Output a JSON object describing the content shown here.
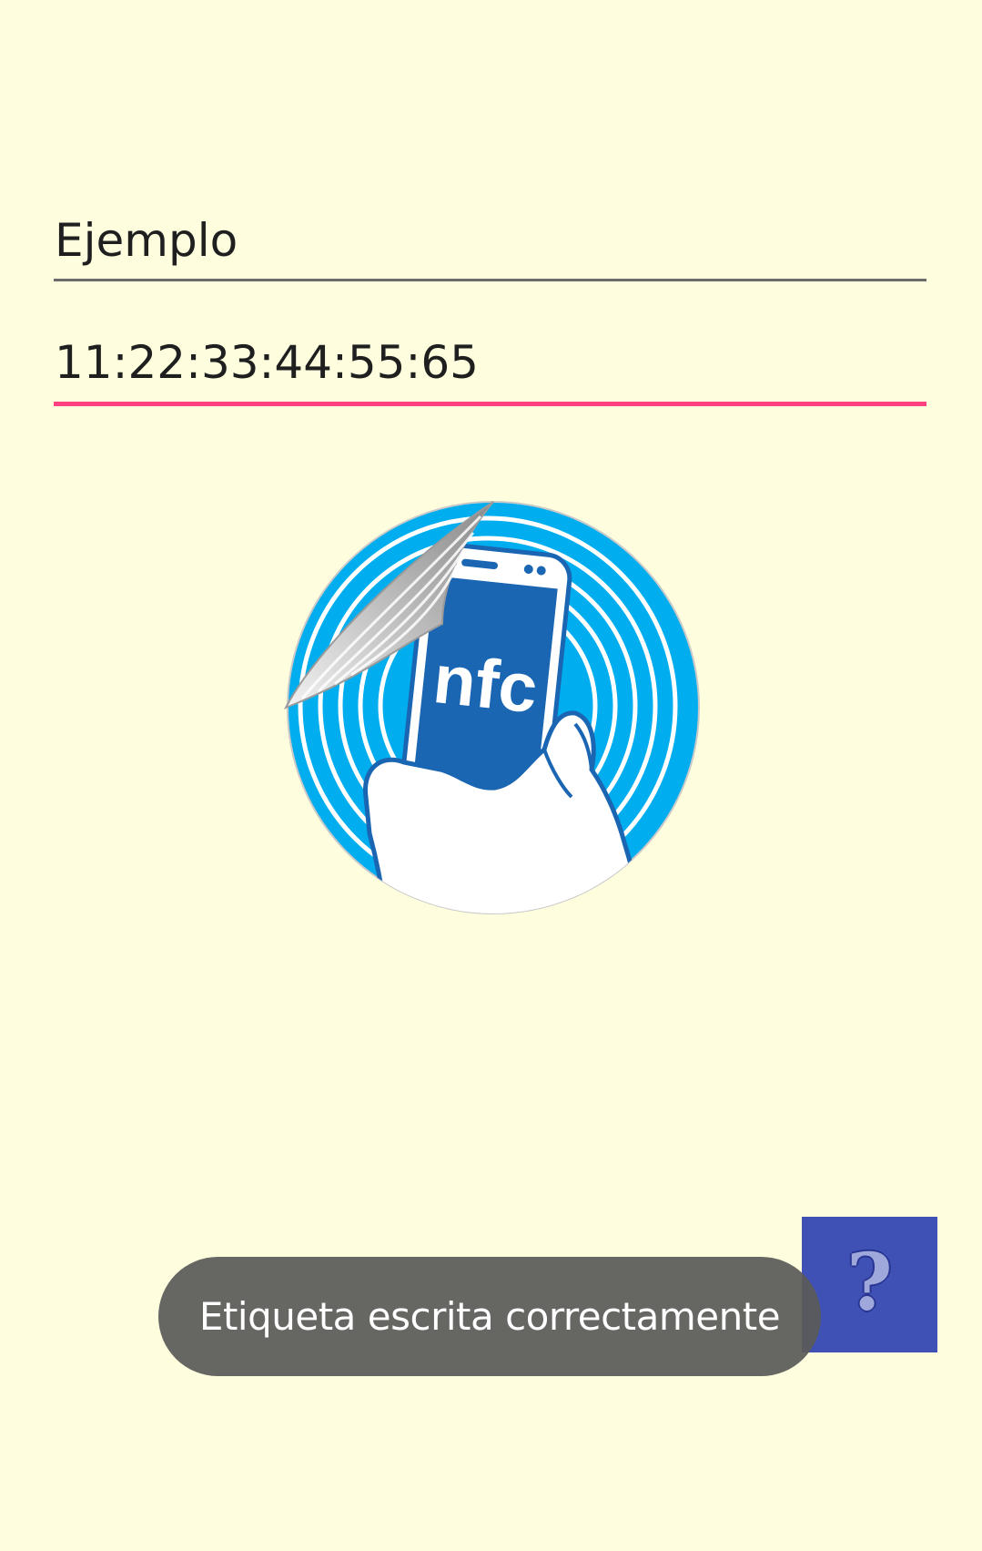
{
  "form": {
    "name_value": "Ejemplo",
    "mac_value": "11:22:33:44:55:65"
  },
  "image": {
    "label": "nfc",
    "icon": "nfc-sticker-icon"
  },
  "help_button": {
    "label": "?",
    "icon": "help-icon",
    "color": "#3F51B5"
  },
  "toast": {
    "message": "Etiqueta escrita correctamente"
  },
  "colors": {
    "background": "#FEFEDF",
    "accent": "#FF4081",
    "nfc_blue": "#00AEEF",
    "phone_blue": "#1A66B3"
  }
}
